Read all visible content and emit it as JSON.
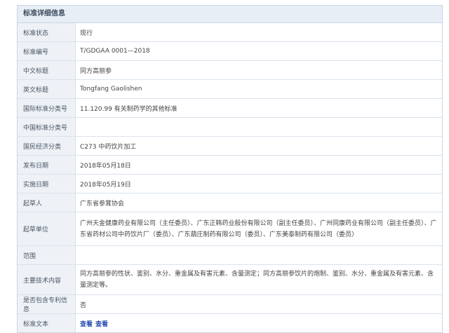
{
  "header": {
    "title": "标准详细信息"
  },
  "rows": [
    {
      "label": "标准状态",
      "value": "现行"
    },
    {
      "label": "标准编号",
      "value": "T/GDGAA 0001—2018"
    },
    {
      "label": "中文标题",
      "value": "同方高丽参"
    },
    {
      "label": "英文标题",
      "value": "Tongfang Gaolishen"
    },
    {
      "label": "国际标准分类号",
      "value": "11.120.99 有关制药学的其他标准"
    },
    {
      "label": "中国标准分类号",
      "value": ""
    },
    {
      "label": "国民经济分类",
      "value": "C273 中药饮片加工"
    },
    {
      "label": "发布日期",
      "value": "2018年05月18日"
    },
    {
      "label": "实施日期",
      "value": "2018年05月19日"
    },
    {
      "label": "起草人",
      "value": "广东省参茸协会"
    },
    {
      "label": "起草单位",
      "value": "广州天金健康药业有限公司（主任委员）、广东正韩药业股份有限公司（副主任委员）、广州同康药业有限公司（副主任委员）、广东省药材公司中药饮片厂（委员）、广东葫庄制药有限公司（委员）、广东美泰制药有限公司（委员）"
    },
    {
      "label": "范围",
      "value": ""
    },
    {
      "label": "主要技术内容",
      "value": "同方高丽参的性状、鉴别、水分、重金属及有害元素、含量测定；同方高丽参饮片的炮制、鉴别、水分、重金属及有害元素、含量测定等。"
    },
    {
      "label": "是否包含专利信息",
      "value": "否"
    },
    {
      "label": "标准文本",
      "links": [
        "查看",
        "查看"
      ]
    }
  ]
}
